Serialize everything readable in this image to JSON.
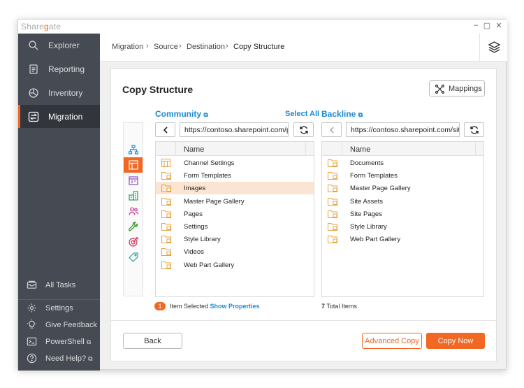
{
  "app": {
    "logo_pre": "Share",
    "logo_accent": "g",
    "logo_post": "ate",
    "minimize": "–",
    "maximize": "▢",
    "close": "✕"
  },
  "sidebar": {
    "items": [
      {
        "label": "Explorer",
        "icon": "search-icon"
      },
      {
        "label": "Reporting",
        "icon": "report-icon"
      },
      {
        "label": "Inventory",
        "icon": "inventory-icon"
      },
      {
        "label": "Migration",
        "icon": "migration-icon"
      }
    ],
    "bottom": [
      {
        "label": "All Tasks",
        "icon": "tasks-icon"
      },
      {
        "label": "Settings",
        "icon": "gear-icon"
      },
      {
        "label": "Give Feedback",
        "icon": "bulb-icon"
      },
      {
        "label": "PowerShell",
        "icon": "terminal-icon",
        "ext": "⧉"
      },
      {
        "label": "Need Help?",
        "icon": "help-icon",
        "ext": "⧉"
      }
    ]
  },
  "breadcrumb": [
    "Migration",
    "Source",
    "Destination",
    "Copy Structure"
  ],
  "breadcrumb_sep": "›",
  "page": {
    "title": "Copy Structure",
    "mappings_label": "Mappings",
    "back_label": "Back",
    "advanced_copy_label": "Advanced Copy",
    "copy_now_label": "Copy Now"
  },
  "source": {
    "site": "Community",
    "select_all": "Select All",
    "url": "https://contoso.sharepoint.com/portals/community",
    "column": "Name",
    "items": [
      {
        "label": "Channel Settings",
        "icon": "list-icon",
        "selected": false
      },
      {
        "label": "Form Templates",
        "icon": "library-icon",
        "selected": false
      },
      {
        "label": "Images",
        "icon": "library-icon",
        "selected": true
      },
      {
        "label": "Master Page Gallery",
        "icon": "library-icon",
        "selected": false
      },
      {
        "label": "Pages",
        "icon": "library-icon",
        "selected": false
      },
      {
        "label": "Settings",
        "icon": "library-icon",
        "selected": false
      },
      {
        "label": "Style Library",
        "icon": "library-icon",
        "selected": false
      },
      {
        "label": "Videos",
        "icon": "library-icon",
        "selected": false
      },
      {
        "label": "Web Part Gallery",
        "icon": "library-icon",
        "selected": false
      }
    ],
    "selected_count": "1",
    "status_text": "Item Selected",
    "show_properties": "Show Properties"
  },
  "destination": {
    "site": "Backline",
    "url": "https://contoso.sharepoint.com/sites/backline",
    "column": "Name",
    "items": [
      {
        "label": "Documents"
      },
      {
        "label": "Form Templates"
      },
      {
        "label": "Master Page Gallery"
      },
      {
        "label": "Site Assets"
      },
      {
        "label": "Site Pages"
      },
      {
        "label": "Style Library"
      },
      {
        "label": "Web Part Gallery"
      }
    ],
    "total_count": "7",
    "total_text": "Total Items"
  },
  "rail": [
    {
      "icon": "sitemap-icon",
      "color": "#1b8bd6"
    },
    {
      "icon": "list-table-icon",
      "color": "#ffffff",
      "active": true
    },
    {
      "icon": "calendar-icon",
      "color": "#8a4fbf"
    },
    {
      "icon": "building-icon",
      "color": "#2e9e5a"
    },
    {
      "icon": "users-icon",
      "color": "#c2338a"
    },
    {
      "icon": "wrench-icon",
      "color": "#3e9a2c"
    },
    {
      "icon": "target-icon",
      "color": "#d2335c"
    },
    {
      "icon": "tag-icon",
      "color": "#2aa59a"
    }
  ],
  "colors": {
    "accent": "#f26722",
    "link": "#1b8bd6",
    "sidebar": "#464a52"
  }
}
